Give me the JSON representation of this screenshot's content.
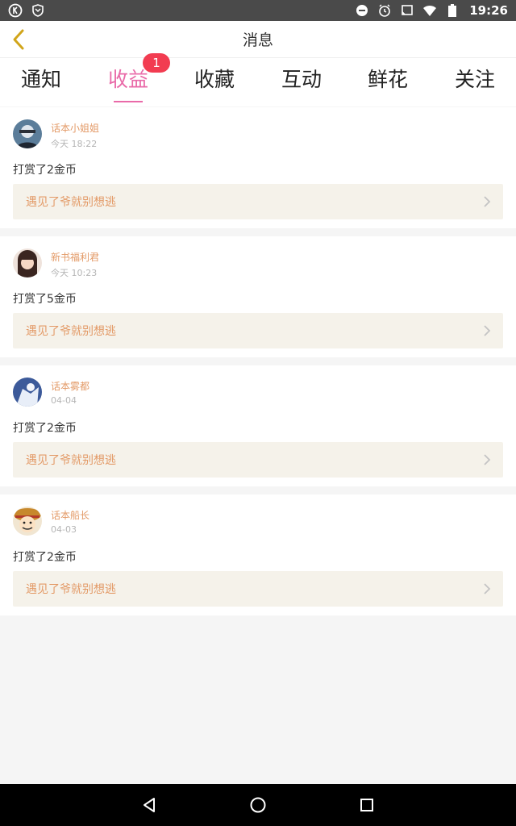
{
  "status_bar": {
    "time": "19:26",
    "left_icons": [
      "k-icon",
      "shield-icon"
    ],
    "right_icons": [
      "do-not-disturb-icon",
      "alarm-icon",
      "cast-icon",
      "wifi-icon",
      "battery-icon"
    ]
  },
  "header": {
    "title": "消息",
    "back_icon": "chevron-left-icon"
  },
  "tabs": [
    {
      "label": "通知"
    },
    {
      "label": "收益",
      "badge": "1",
      "active": true
    },
    {
      "label": "收藏"
    },
    {
      "label": "互动"
    },
    {
      "label": "鲜花"
    },
    {
      "label": "关注"
    }
  ],
  "messages": [
    {
      "user": "话本小姐姐",
      "time": "今天 18:22",
      "action": "打赏了2金币",
      "book": "遇见了爷就别想逃"
    },
    {
      "user": "新书福利君",
      "time": "今天 10:23",
      "action": "打赏了5金币",
      "book": "遇见了爷就别想逃"
    },
    {
      "user": "话本雾都",
      "time": "04-04",
      "action": "打赏了2金币",
      "book": "遇见了爷就别想逃"
    },
    {
      "user": "话本船长",
      "time": "04-03",
      "action": "打赏了2金币",
      "book": "遇见了爷就别想逃"
    }
  ],
  "colors": {
    "accent_pink": "#e96aa8",
    "badge_red": "#f23c51",
    "username_orange": "#e39a67",
    "book_box_bg": "#f5f2ea",
    "back_arrow": "#d1a51a"
  }
}
